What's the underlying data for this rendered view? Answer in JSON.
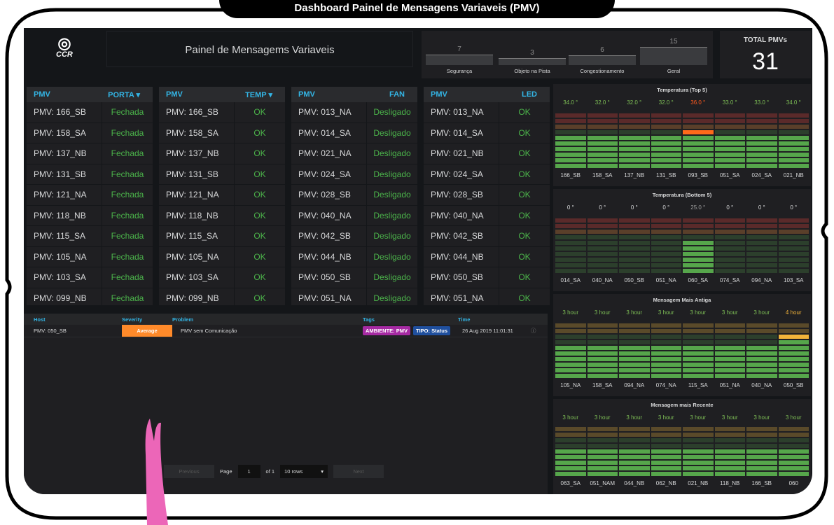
{
  "title": "Dashboard Painel de Mensagens Variaveis (PMV)",
  "header": {
    "logo_text": "CCR",
    "title": "Painel de Mensagems Variaveis"
  },
  "stats": [
    {
      "value": "7",
      "label": "Segurança",
      "level": 0.45
    },
    {
      "value": "3",
      "label": "Objeto na Pista",
      "level": 0.2
    },
    {
      "value": "6",
      "label": "Congestionamento",
      "level": 0.4
    },
    {
      "value": "15",
      "label": "Geral",
      "level": 1.0
    }
  ],
  "total": {
    "label": "TOTAL PMVs",
    "value": "31"
  },
  "tables": [
    {
      "h1": "PMV",
      "h2": "PORTA ▾",
      "status": "Fechada",
      "rows": [
        "PMV: 166_SB",
        "PMV: 158_SA",
        "PMV: 137_NB",
        "PMV: 131_SB",
        "PMV: 121_NA",
        "PMV: 118_NB",
        "PMV: 115_SA",
        "PMV: 105_NA",
        "PMV: 103_SA",
        "PMV: 099_NB"
      ]
    },
    {
      "h1": "PMV",
      "h2": "TEMP ▾",
      "status": "OK",
      "rows": [
        "PMV: 166_SB",
        "PMV: 158_SA",
        "PMV: 137_NB",
        "PMV: 131_SB",
        "PMV: 121_NA",
        "PMV: 118_NB",
        "PMV: 115_SA",
        "PMV: 105_NA",
        "PMV: 103_SA",
        "PMV: 099_NB"
      ]
    },
    {
      "h1": "PMV",
      "h2": "FAN",
      "status": "Desligado",
      "rows": [
        "PMV: 013_NA",
        "PMV: 014_SA",
        "PMV: 021_NA",
        "PMV: 024_SA",
        "PMV: 028_SB",
        "PMV: 040_NA",
        "PMV: 042_SB",
        "PMV: 044_NB",
        "PMV: 050_SB",
        "PMV: 051_NA"
      ]
    },
    {
      "h1": "PMV",
      "h2": "LED",
      "status": "OK",
      "rows": [
        "PMV: 013_NA",
        "PMV: 014_SA",
        "PMV: 021_NB",
        "PMV: 024_SA",
        "PMV: 028_SB",
        "PMV: 040_NA",
        "PMV: 042_SB",
        "PMV: 044_NB",
        "PMV: 050_SB",
        "PMV: 051_NA"
      ]
    }
  ],
  "alerts": {
    "headers": {
      "host": "Host",
      "severity": "Severity",
      "problem": "Problem",
      "tags": "Tags",
      "time": "Time"
    },
    "row": {
      "host": "PMV: 050_SB",
      "severity": "Average",
      "problem": "PMV sem Comunicação",
      "tag1": "AMBIENTE: PMV",
      "tag2": "TIPO: Status",
      "time": "26 Aug 2019 11:01:31"
    },
    "pager": {
      "prev": "Previous",
      "page": "Page",
      "page_value": "1",
      "of": "of 1",
      "rows": "10 rows",
      "next": "Next"
    }
  },
  "gauges": [
    {
      "title": "Temperatura (Top 5)",
      "values": [
        "34.0 °",
        "32.0 °",
        "32.0 °",
        "32.0 °",
        "36.0 °",
        "33.0 °",
        "33.0 °",
        "34.0 °"
      ],
      "labels": [
        "166_SB",
        "158_SA",
        "137_NB",
        "131_SB",
        "093_SB",
        "051_SA",
        "024_SA",
        "021_NB"
      ],
      "levels": [
        0.55,
        0.55,
        0.55,
        0.55,
        0.65,
        0.55,
        0.55,
        0.55
      ],
      "hot": [
        false,
        false,
        false,
        false,
        true,
        false,
        false,
        false
      ]
    },
    {
      "title": "Temperatura (Bottom 5)",
      "values": [
        "0 °",
        "0 °",
        "0 °",
        "0 °",
        "25.0 °",
        "0 °",
        "0 °",
        "0 °"
      ],
      "labels": [
        "014_SA",
        "040_NA",
        "050_SB",
        "051_NA",
        "060_SA",
        "074_SA",
        "094_NA",
        "103_SA"
      ],
      "levels": [
        0,
        0,
        0,
        0,
        0.55,
        0,
        0,
        0
      ],
      "hot": [
        false,
        false,
        false,
        false,
        false,
        false,
        false,
        false
      ]
    },
    {
      "title": "Mensagem Mais Antiga",
      "values": [
        "3 hour",
        "3 hour",
        "3 hour",
        "3 hour",
        "3 hour",
        "3 hour",
        "3 hour",
        "4 hour"
      ],
      "labels": [
        "105_NA",
        "158_SA",
        "094_NA",
        "074_NA",
        "115_SA",
        "051_NA",
        "040_NA",
        "050_SB"
      ],
      "levels": [
        0.6,
        0.6,
        0.6,
        0.6,
        0.6,
        0.6,
        0.6,
        0.8
      ],
      "hot": [
        false,
        false,
        false,
        false,
        false,
        false,
        false,
        true
      ]
    },
    {
      "title": "Mensagem mais Recente",
      "values": [
        "3 hour",
        "3 hour",
        "3 hour",
        "3 hour",
        "3 hour",
        "3 hour",
        "3 hour",
        "3 hour"
      ],
      "labels": [
        "063_SA",
        "051_NAM",
        "044_NB",
        "062_NB",
        "021_NB",
        "118_NB",
        "166_SB",
        "060"
      ],
      "levels": [
        0.6,
        0.6,
        0.6,
        0.6,
        0.6,
        0.6,
        0.6,
        0.6
      ],
      "hot": [
        false,
        false,
        false,
        false,
        false,
        false,
        false,
        false
      ]
    }
  ],
  "colors": {
    "green": "#4bb34a",
    "orange": "#ff8a2a",
    "blue": "#33b5e5",
    "pink": "#ec66b8"
  }
}
